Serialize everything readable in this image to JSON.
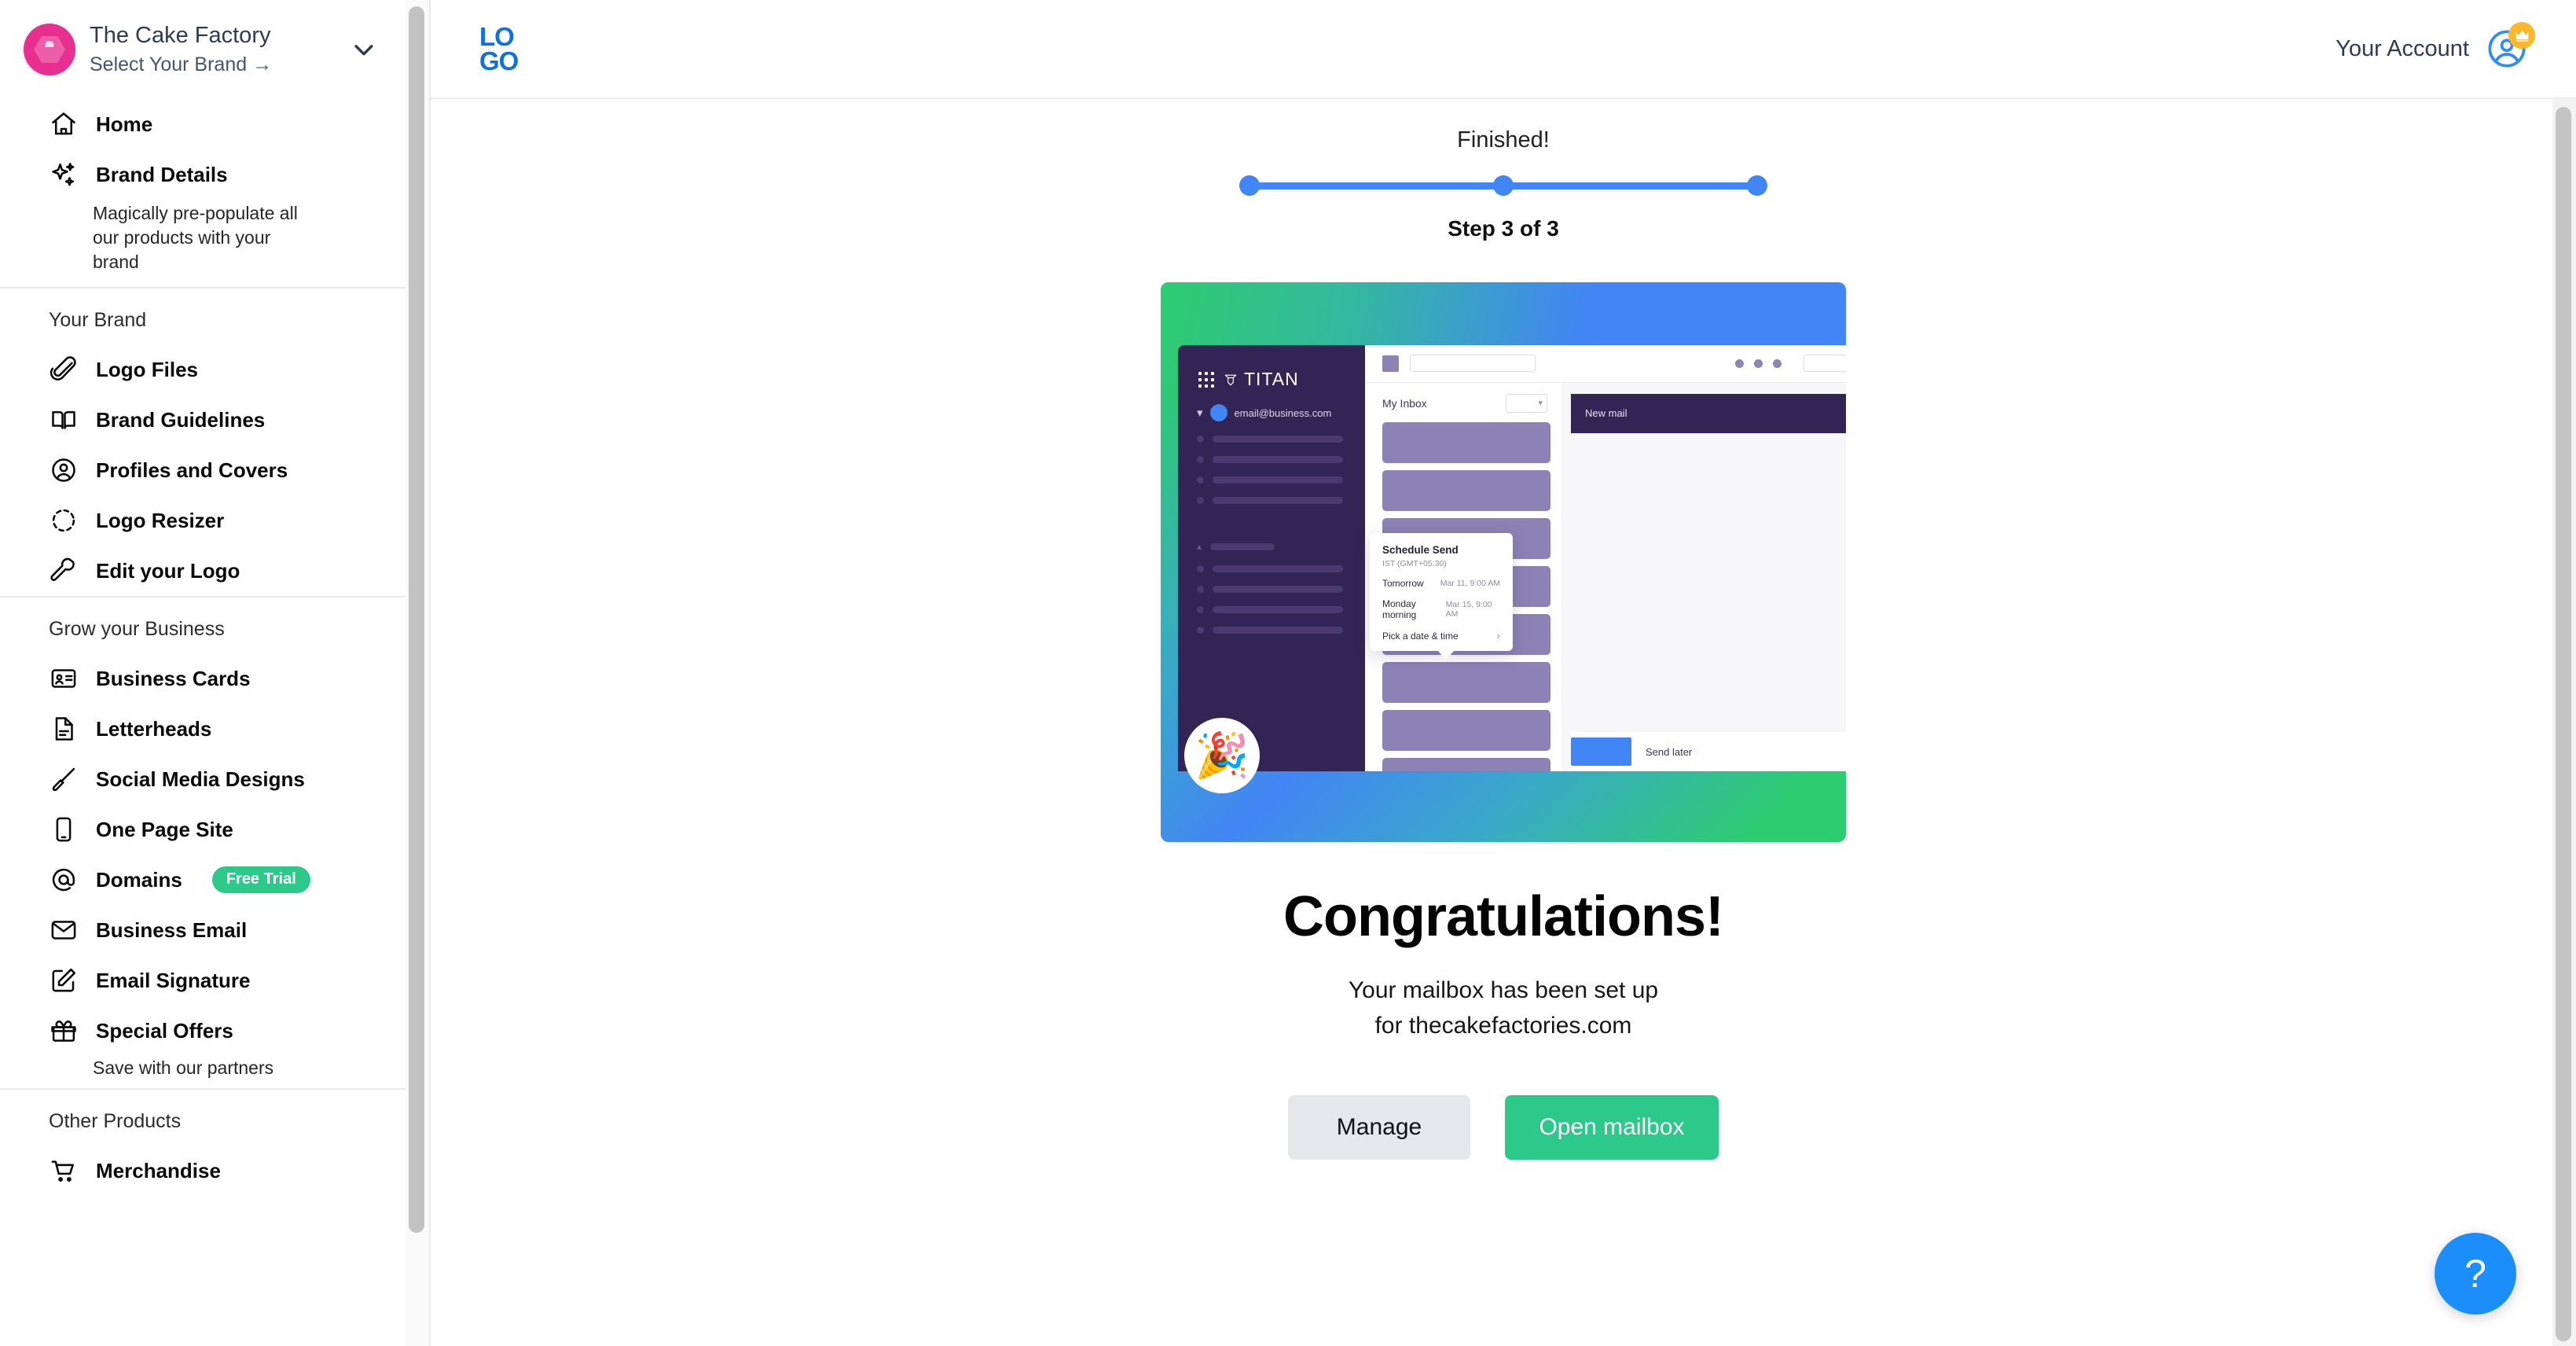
{
  "sidebar": {
    "brand": {
      "name": "The Cake Factory",
      "select_brand": "Select Your Brand →",
      "avatar_icon": "cake-hexagon-logo",
      "chevron_icon": "chevron-down-icon"
    },
    "primary": [
      {
        "label": "Home",
        "icon": "home-icon"
      },
      {
        "label": "Brand Details",
        "icon": "sparkles-icon",
        "sub": "Magically pre-populate all our products with your brand"
      }
    ],
    "groups": [
      {
        "title": "Your Brand",
        "items": [
          {
            "label": "Logo Files",
            "icon": "paperclip-icon"
          },
          {
            "label": "Brand Guidelines",
            "icon": "open-book-icon"
          },
          {
            "label": "Profiles and Covers",
            "icon": "user-circle-icon"
          },
          {
            "label": "Logo Resizer",
            "icon": "resize-icon"
          },
          {
            "label": "Edit your Logo",
            "icon": "wrench-icon"
          }
        ]
      },
      {
        "title": "Grow your Business",
        "items": [
          {
            "label": "Business Cards",
            "icon": "id-card-icon"
          },
          {
            "label": "Letterheads",
            "icon": "document-icon"
          },
          {
            "label": "Social Media Designs",
            "icon": "paintbrush-icon"
          },
          {
            "label": "One Page Site",
            "icon": "mobile-phone-icon"
          },
          {
            "label": "Domains",
            "icon": "at-sign-icon",
            "badge": "Free Trial"
          },
          {
            "label": "Business Email",
            "icon": "envelope-icon"
          },
          {
            "label": "Email Signature",
            "icon": "pencil-square-icon"
          },
          {
            "label": "Special Offers",
            "icon": "gift-icon",
            "sub": "Save with our partners"
          }
        ]
      },
      {
        "title": "Other Products",
        "items": [
          {
            "label": "Merchandise",
            "icon": "shopping-cart-icon"
          }
        ]
      }
    ]
  },
  "topbar": {
    "logo_line1": "LO",
    "logo_line2": "GO",
    "account_label": "Your Account",
    "account_icon": "user-avatar-icon",
    "badge_icon": "crown-icon"
  },
  "progress": {
    "status": "Finished!",
    "step_text": "Step 3 of 3",
    "current_step": 3,
    "total_steps": 3,
    "accent_color": "#4285f4"
  },
  "hero": {
    "app_name": "TITAN",
    "grid_icon": "app-grid-icon",
    "account_email": "email@business.com",
    "inbox_label": "My Inbox",
    "new_mail_label": "New mail",
    "send_later_label": "Send later",
    "tooltip": {
      "title": "Schedule Send",
      "timezone": "IST (GMT+05:30)",
      "options": [
        {
          "label": "Tomorrow",
          "value": "Mar 11, 9:00 AM"
        },
        {
          "label": "Monday morning",
          "value": "Mar 15, 9:00 AM"
        },
        {
          "label": "Pick a date & time",
          "value": ""
        }
      ]
    },
    "celebration_icon": "🎉",
    "gradient_colors": [
      "#2ecc71",
      "#4285f4",
      "#2ecc71"
    ]
  },
  "result": {
    "heading": "Congratulations!",
    "line1": "Your mailbox has been set up",
    "line2": "for thecakefactories.com",
    "manage_label": "Manage",
    "open_label": "Open mailbox",
    "open_color": "#2cc98a"
  },
  "help": {
    "label": "?",
    "icon": "question-mark-icon",
    "color": "#1c8ef9"
  }
}
